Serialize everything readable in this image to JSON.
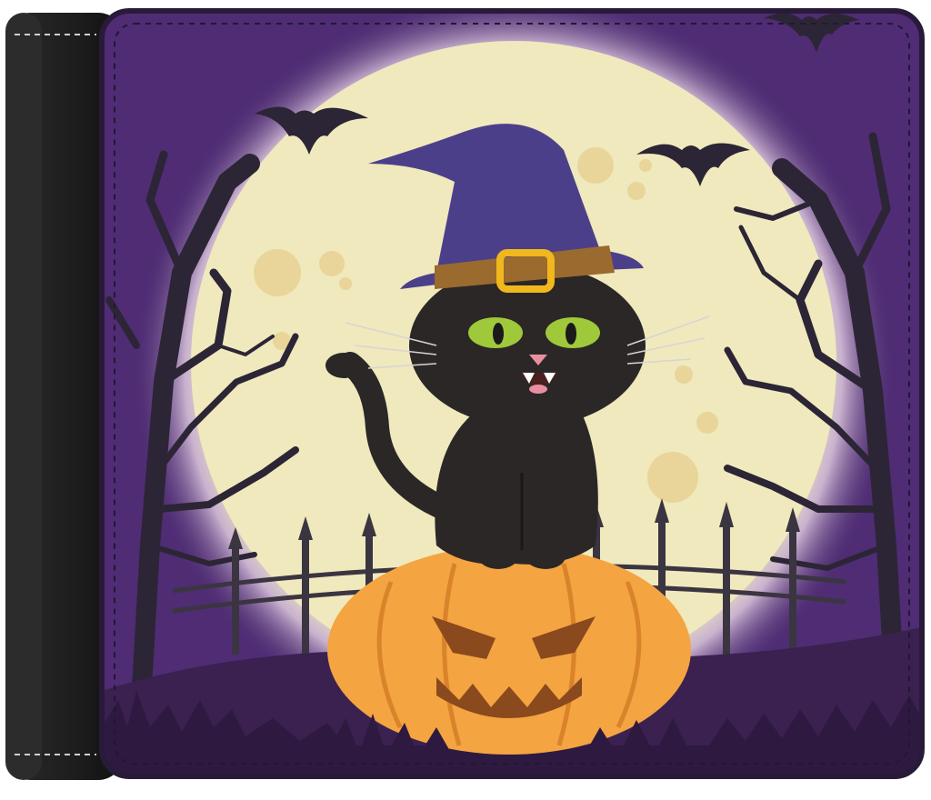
{
  "image": {
    "subject": "wallet-product-photo",
    "colors": {
      "background": "#ffffff",
      "leather": "#1f1f1f",
      "leather_highlight": "#3a3a3a",
      "stitch": "#cfcfcf",
      "sky_purple": "#4b2a6e",
      "sky_purple_light": "#6a3f8c",
      "moon_glow": "#c9b2cf",
      "moon": "#efe9bd",
      "moon_spot": "#e9d59a",
      "silhouette": "#2c2535",
      "ground": "#3a2150",
      "fence": "#3b3541",
      "hat": "#4c3f8a",
      "hat_band": "#9a6a2e",
      "buckle": "#f0b81c",
      "cat": "#2b2727",
      "cat_eye": "#9fc93a",
      "cat_nose": "#e890a0",
      "pumpkin": "#f4a441",
      "pumpkin_shade": "#d9832a",
      "pumpkin_face": "#8a4a1e"
    },
    "icons": [
      "bat-icon",
      "witch-hat-icon",
      "pumpkin-icon",
      "moon-icon",
      "tree-icon",
      "fence-icon"
    ]
  }
}
